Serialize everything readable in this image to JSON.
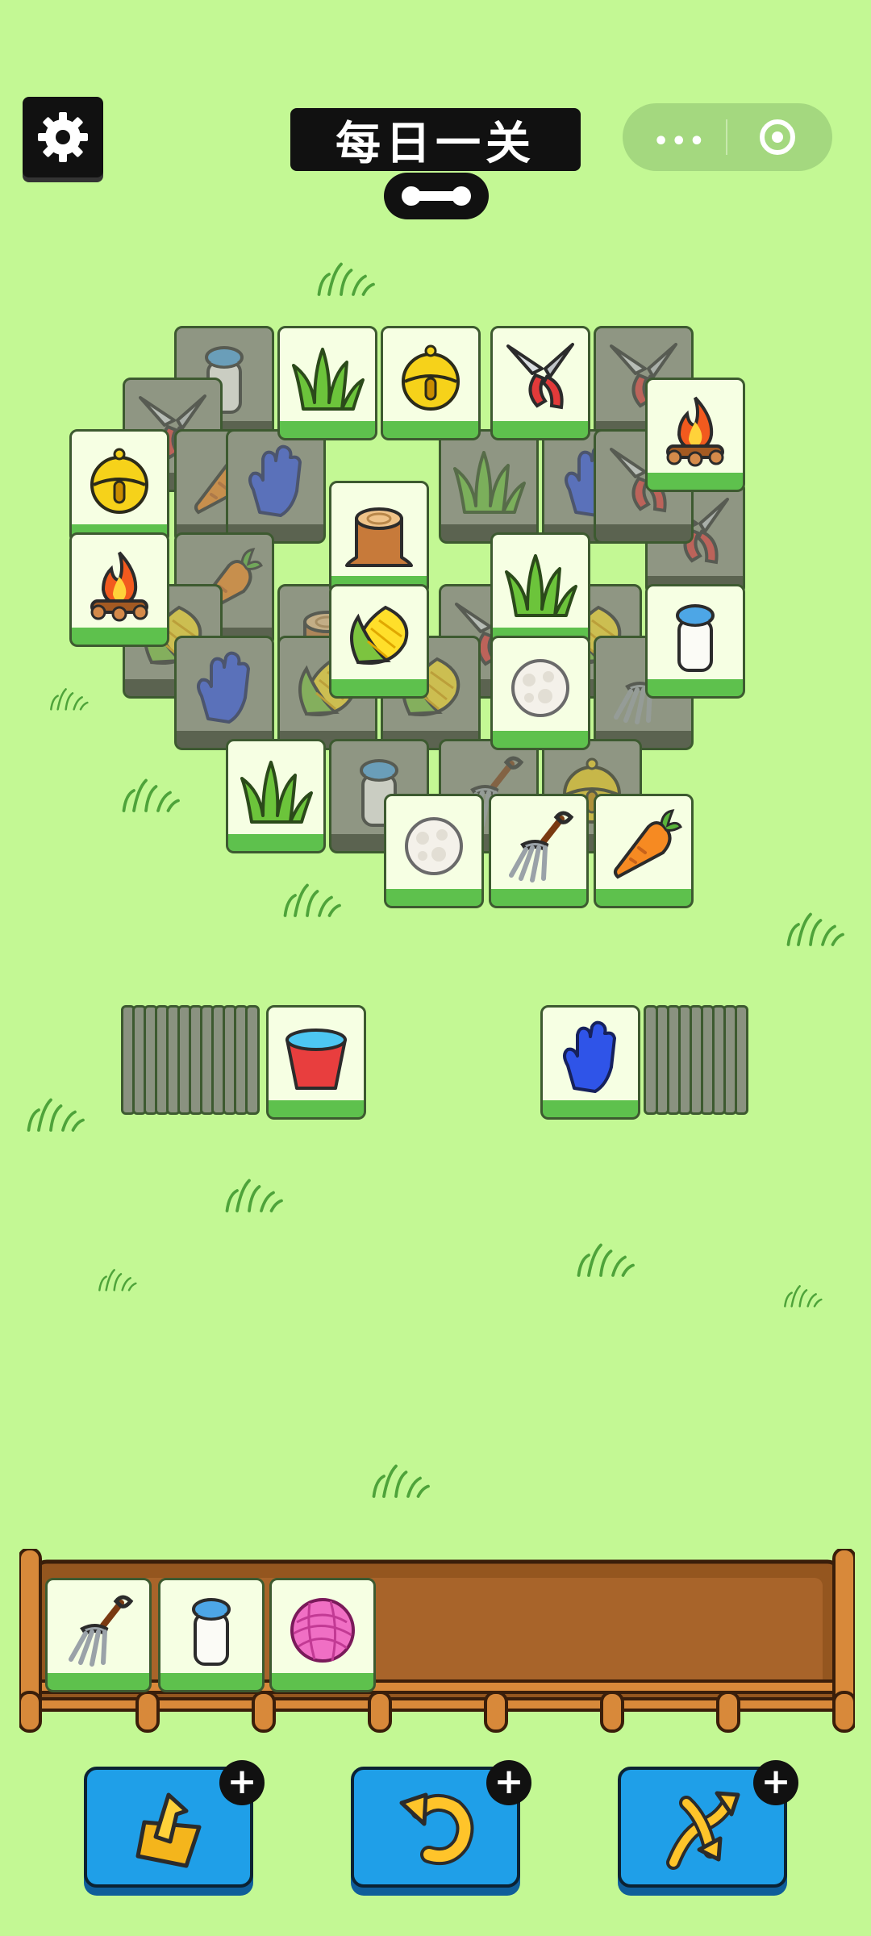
{
  "header": {
    "title": "每日一关",
    "settings_icon": "gear-icon",
    "menu_icon": "more-dots-icon",
    "close_icon": "target-circle-icon",
    "badge_icon": "bone-icon"
  },
  "board": {
    "tile_items": [
      "jar",
      "grass",
      "bell",
      "pruner",
      "pruner",
      "pruner",
      "fire",
      "bell",
      "fire",
      "stump",
      "grass",
      "corn",
      "jar",
      "cotton",
      "grass",
      "cotton",
      "fork",
      "carrot"
    ]
  },
  "stacks": {
    "left_top_item": "bucket",
    "right_top_item": "glove"
  },
  "tray": {
    "slots": [
      "fork",
      "jar",
      "yarn"
    ],
    "capacity": 7
  },
  "powerups": [
    {
      "name": "move-out",
      "icon": "move-out-icon"
    },
    {
      "name": "undo",
      "icon": "undo-icon"
    },
    {
      "name": "shuffle",
      "icon": "shuffle-icon"
    }
  ],
  "colors": {
    "background": "#c3f894",
    "tile_face": "#f6ffe3",
    "tile_base": "#5ec14d",
    "button_blue": "#1f9fe8",
    "tray_wood": "#94561f"
  }
}
